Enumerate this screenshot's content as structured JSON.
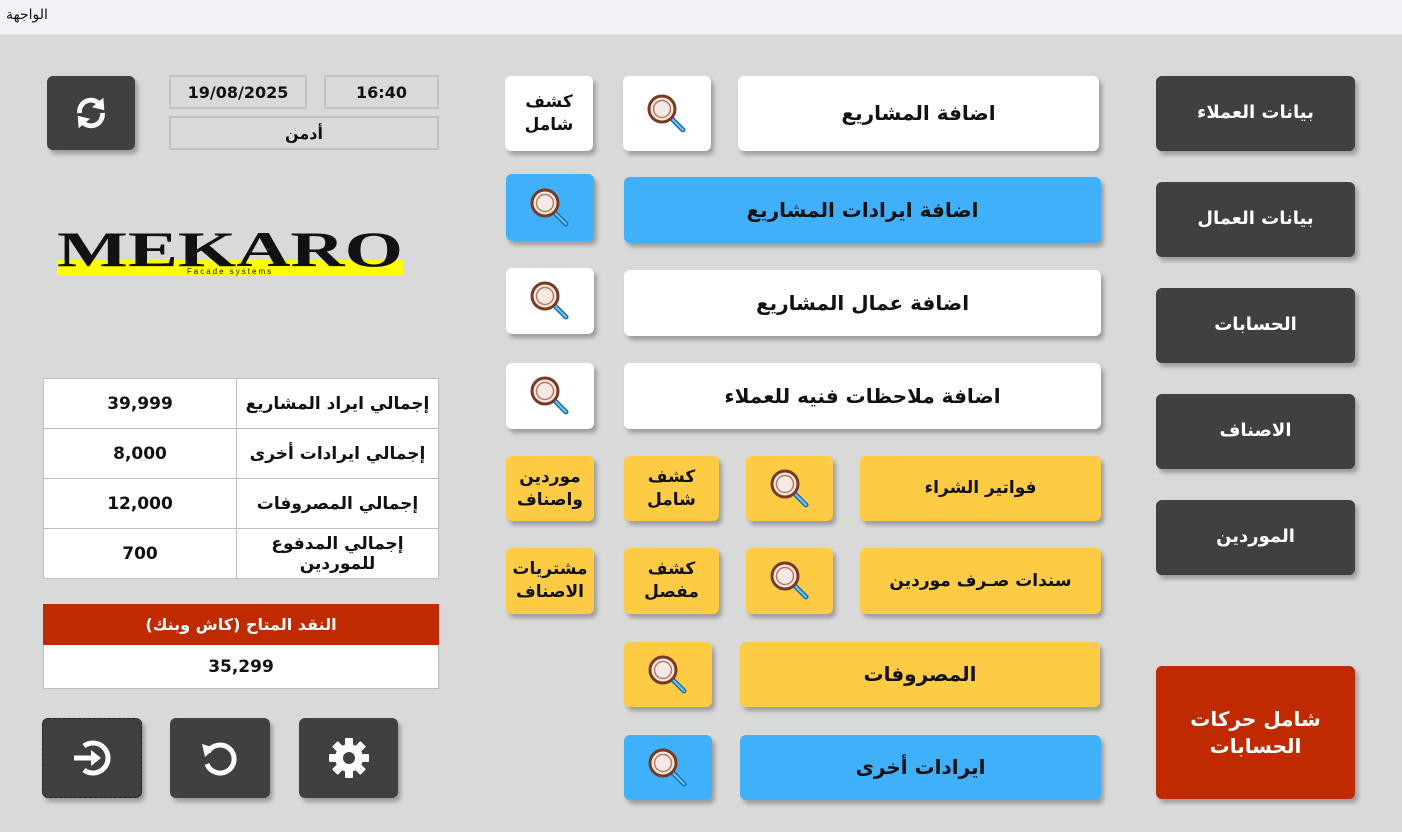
{
  "window": {
    "title": "الواجهة"
  },
  "header": {
    "date": "19/08/2025",
    "time": "16:40",
    "user": "أدمن"
  },
  "logo": {
    "name": "MEKARO",
    "tagline": "Facade systems"
  },
  "summary": {
    "rows": [
      {
        "label": "إجمالي ايراد المشاريع",
        "value": "39,999"
      },
      {
        "label": "إجمالي ايرادات أخرى",
        "value": "8,000"
      },
      {
        "label": "إجمالي المصروفات",
        "value": "12,000"
      },
      {
        "label": "إجمالي المدفوع للموردين",
        "value": "700"
      }
    ]
  },
  "cash": {
    "label": "النقد المتاح (كاش وبنك)",
    "value": "35,299"
  },
  "sidebar": {
    "customers": "بيانات العملاء",
    "workers": "بيانات العمال",
    "accounts": "الحسابات",
    "items": "الاصناف",
    "suppliers": "الموردين",
    "all_transactions": "شامل حركات الحسابات"
  },
  "actions": {
    "add_projects": "اضافة المشاريع",
    "comprehensive_statement": "كشف شامل",
    "add_project_revenues": "اضافة ايرادات المشاريع",
    "add_project_workers": "اضافة عمال المشاريع",
    "add_technical_notes": "اضافة ملاحظات فنيه للعملاء",
    "purchase_invoices": "فواتير الشراء",
    "comprehensive_statement_2": "كشف شامل",
    "suppliers_items": "موردين واصناف",
    "supplier_payments": "سندات صـرف موردين",
    "detailed_statement": "كشف مفصل",
    "items_purchases": "مشتريات الاصناف",
    "expenses": "المصروفات",
    "other_revenues": "ايرادات أخرى"
  },
  "colors": {
    "dark": "#404040",
    "blue": "#41b0fb",
    "yellow": "#fecb44",
    "red": "#c02a00",
    "logo_yellow": "#ffff00"
  },
  "icons": {
    "refresh": "refresh-icon",
    "search": "magnifier-icon",
    "logout": "logout-icon",
    "undo": "undo-icon",
    "settings": "gear-icon"
  }
}
